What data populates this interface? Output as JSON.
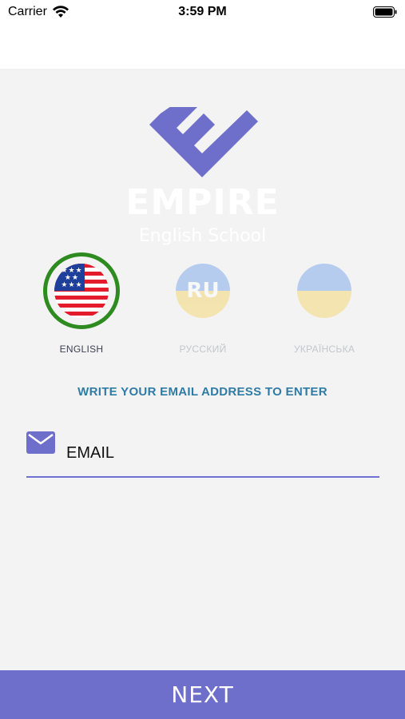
{
  "status_bar": {
    "carrier": "Carrier",
    "time": "3:59 PM"
  },
  "logo": {
    "name": "EMPIRE",
    "subtitle": "English School"
  },
  "languages": [
    {
      "label": "ENGLISH",
      "selected": true,
      "flag_icon": "us-flag-icon"
    },
    {
      "label": "РУССКИЙ",
      "selected": false,
      "flag_icon": "ru-flag-icon",
      "flag_text": "RU"
    },
    {
      "label": "УКРАЇНСЬКА",
      "selected": false,
      "flag_icon": "ua-flag-icon"
    }
  ],
  "instruction": "WRITE YOUR EMAIL ADDRESS TO ENTER",
  "email": {
    "placeholder": "EMAIL",
    "value": ""
  },
  "next_button": {
    "label": "NEXT"
  },
  "colors": {
    "accent": "#6e6fca",
    "selected_ring": "#2e8b1f",
    "instruction_text": "#2f7ba5",
    "background": "#f3f3f4"
  }
}
